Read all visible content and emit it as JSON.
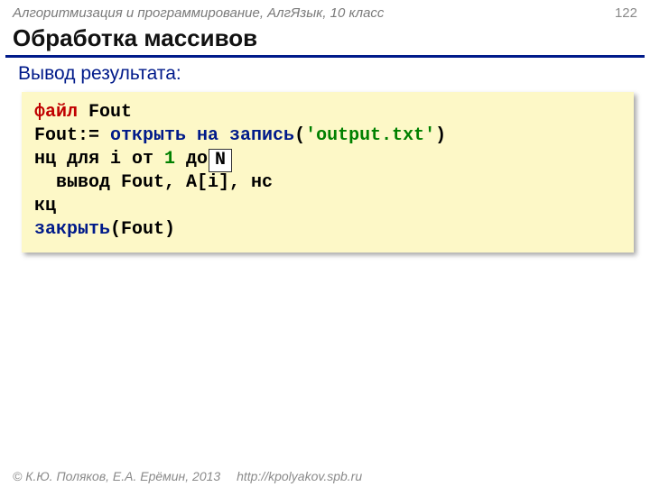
{
  "header": {
    "course": "Алгоритмизация и программирование, АлгЯзык, 10 класс",
    "page": "122"
  },
  "title": "Обработка массивов",
  "subtitle": "Вывод результата:",
  "code": {
    "l1_kw": "файл",
    "l1_rest": " Fout",
    "l2_a": "Fout:= ",
    "l2_kw": "открыть на запись",
    "l2_b": "(",
    "l2_str": "'output.txt'",
    "l2_c": ")",
    "l3_a": "нц для i от ",
    "l3_num": "1",
    "l3_b": " до  ",
    "l4": "  вывод Fout, A[i], нс",
    "l5": "кц",
    "l6_kw": "закрыть",
    "l6_rest": "(Fout)",
    "nbox": "N"
  },
  "footer": {
    "copyright": "© К.Ю. Поляков, Е.А. Ерёмин, 2013",
    "url": "http://kpolyakov.spb.ru"
  }
}
